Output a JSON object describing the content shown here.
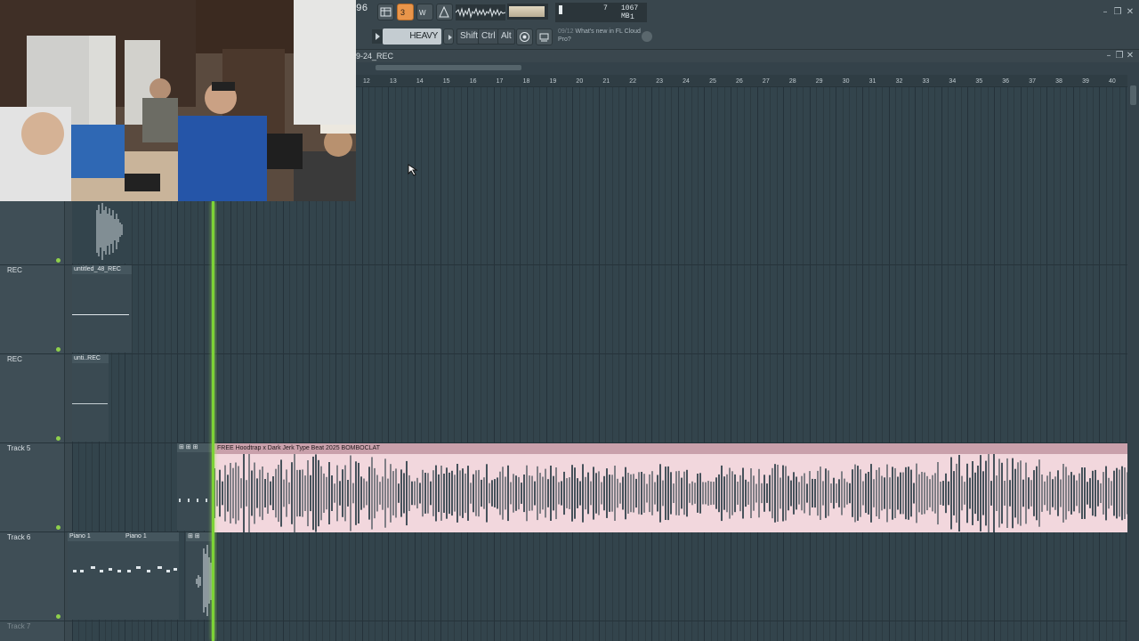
{
  "toolbar": {
    "tempo_stub": "96",
    "pattern_name": "HEAVY",
    "shift_label": "Shift",
    "ctrl_label": "Ctrl",
    "alt_label": "Alt",
    "memory": "1067 MB",
    "cpu_value": "7",
    "voices": "1",
    "news_date": "09/12",
    "news_text": "What's new in FL Cloud Pro?"
  },
  "playlist": {
    "title": "9-24_REC",
    "ruler_ticks": [
      "12",
      "13",
      "14",
      "15",
      "16",
      "17",
      "18",
      "19",
      "20",
      "21",
      "22",
      "23",
      "24",
      "25",
      "26",
      "27",
      "28",
      "29",
      "30",
      "31",
      "32",
      "33",
      "34",
      "35",
      "36",
      "37",
      "38",
      "39",
      "40"
    ]
  },
  "tracks": [
    {
      "label": "REC"
    },
    {
      "label": "REC"
    },
    {
      "label": "Track 5"
    },
    {
      "label": "Track 6"
    },
    {
      "label": "Track 7"
    }
  ],
  "clips": {
    "rec1": "untitled_48_REC",
    "rec2": "unti..REC",
    "audio": "FREE Hoodtrap x Dark Jerk Type Beat 2025 BOMBOCLAT",
    "piano1": "Piano 1",
    "piano2": "Piano 1"
  },
  "colors": {
    "audio_clip": "#f2d7dd",
    "playhead": "#7dd336",
    "accent_button": "#e9954a"
  }
}
